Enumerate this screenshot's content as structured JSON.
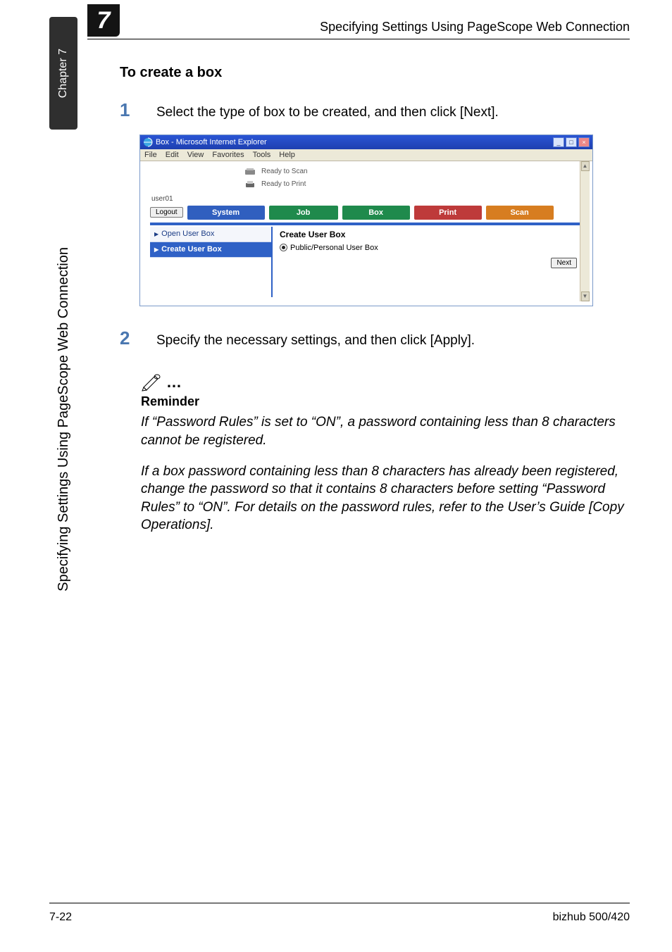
{
  "header": {
    "chapter_number": "7",
    "title": "Specifying Settings Using PageScope Web Connection"
  },
  "sidetab": {
    "label": "Chapter 7"
  },
  "vertical_caption": "Specifying Settings Using PageScope Web Connection",
  "section": {
    "heading": "To create a box",
    "step1_num": "1",
    "step1_text": "Select the type of box to be created, and then click [Next].",
    "step2_num": "2",
    "step2_text": "Specify the necessary settings, and then click [Apply]."
  },
  "screenshot": {
    "window_title": "Box - Microsoft Internet Explorer",
    "menus": [
      "File",
      "Edit",
      "View",
      "Favorites",
      "Tools",
      "Help"
    ],
    "status": {
      "scan": "Ready to Scan",
      "print": "Ready to Print"
    },
    "user_label": "user01",
    "logout_label": "Logout",
    "tabs": {
      "system": "System",
      "job": "Job",
      "box": "Box",
      "print": "Print",
      "scan": "Scan"
    },
    "sidebar": {
      "open": "Open User Box",
      "create": "Create User Box"
    },
    "panel": {
      "title": "Create User Box",
      "radio_label": "Public/Personal User Box",
      "next": "Next"
    },
    "window_buttons": {
      "min": "_",
      "max": "□",
      "close": "×"
    }
  },
  "reminder": {
    "ellipsis": "…",
    "heading": "Reminder",
    "p1": "If “Password Rules” is set to “ON”, a password containing less than 8 characters cannot be registered.",
    "p2": "If a box password containing less than 8 characters has already been registered, change the password so that it contains 8 characters before setting “Password Rules” to “ON”. For details on the password rules, refer to the User’s Guide [Copy Operations]."
  },
  "footer": {
    "page": "7-22",
    "product": "bizhub 500/420"
  }
}
